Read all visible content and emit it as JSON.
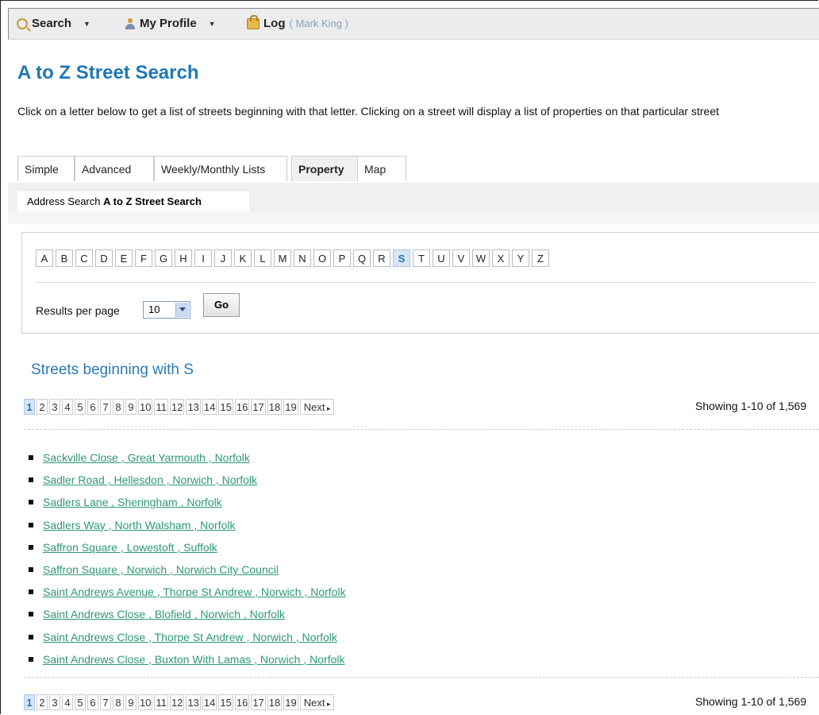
{
  "topbar": {
    "search_label": "Search",
    "profile_label": "My Profile",
    "log_label": "Log",
    "user_name": "( Mark King )"
  },
  "page": {
    "title": "A to Z Street Search",
    "intro": "Click on a letter below to get a list of streets beginning with that letter. Clicking on a street will display a list of properties on that particular street"
  },
  "tabs": [
    "Simple",
    "Advanced",
    "Weekly/Monthly Lists",
    "Property",
    "Map"
  ],
  "active_tab": "Property",
  "subtabs": {
    "address_search": "Address Search",
    "a_to_z": "A to Z Street Search"
  },
  "letters": [
    "A",
    "B",
    "C",
    "D",
    "E",
    "F",
    "G",
    "H",
    "I",
    "J",
    "K",
    "L",
    "M",
    "N",
    "O",
    "P",
    "Q",
    "R",
    "S",
    "T",
    "U",
    "V",
    "W",
    "X",
    "Y",
    "Z"
  ],
  "active_letter": "S",
  "results_per_page": {
    "label": "Results per page",
    "selected": "10",
    "go_label": "Go"
  },
  "results_heading": "Streets beginning with S",
  "pagination": {
    "pages": [
      "1",
      "2",
      "3",
      "4",
      "5",
      "6",
      "7",
      "8",
      "9",
      "10",
      "11",
      "12",
      "13",
      "14",
      "15",
      "16",
      "17",
      "18",
      "19"
    ],
    "current": "1",
    "next_label": "Next",
    "showing_text": "Showing 1-10 of 1,569"
  },
  "streets": [
    "Sackville Close , Great Yarmouth , Norfolk",
    "Sadler Road , Hellesdon , Norwich , Norfolk",
    "Sadlers Lane , Sheringham , Norfolk",
    "Sadlers Way , North Walsham , Norfolk",
    "Saffron Square , Lowestoft , Suffolk",
    "Saffron Square , Norwich , Norwich City Council",
    "Saint Andrews Avenue , Thorpe St Andrew , Norwich , Norfolk",
    "Saint Andrews Close , Blofield , Norwich , Norfolk",
    "Saint Andrews Close , Thorpe St Andrew , Norwich , Norfolk",
    "Saint Andrews Close , Buxton With Lamas , Norwich , Norfolk"
  ]
}
